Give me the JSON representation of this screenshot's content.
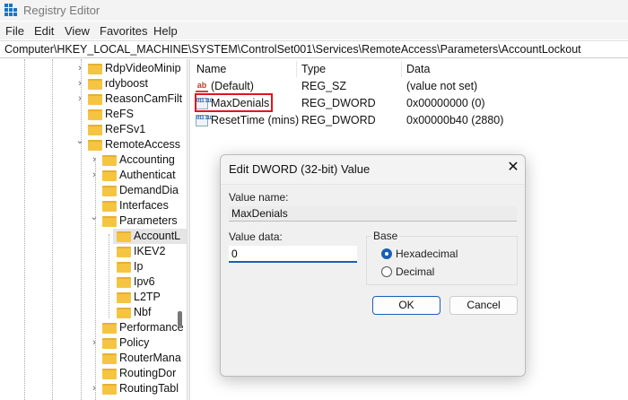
{
  "window": {
    "title": "Registry Editor"
  },
  "menu": [
    "File",
    "Edit",
    "View",
    "Favorites",
    "Help"
  ],
  "address": "Computer\\HKEY_LOCAL_MACHINE\\SYSTEM\\ControlSet001\\Services\\RemoteAccess\\Parameters\\AccountLockout",
  "tree": [
    {
      "label": "RdpVideoMinip",
      "level": 0,
      "exp": "closed"
    },
    {
      "label": "rdyboost",
      "level": 0,
      "exp": "closed"
    },
    {
      "label": "ReasonCamFilt",
      "level": 0,
      "exp": "closed"
    },
    {
      "label": "ReFS",
      "level": 0,
      "exp": "none"
    },
    {
      "label": "ReFSv1",
      "level": 0,
      "exp": "none"
    },
    {
      "label": "RemoteAccess",
      "level": 0,
      "exp": "open"
    },
    {
      "label": "Accounting",
      "level": 1,
      "exp": "closed"
    },
    {
      "label": "Authenticat",
      "level": 1,
      "exp": "closed"
    },
    {
      "label": "DemandDia",
      "level": 1,
      "exp": "none"
    },
    {
      "label": "Interfaces",
      "level": 1,
      "exp": "none"
    },
    {
      "label": "Parameters",
      "level": 1,
      "exp": "open"
    },
    {
      "label": "AccountL",
      "level": 2,
      "exp": "none",
      "selected": true
    },
    {
      "label": "IKEV2",
      "level": 2,
      "exp": "none"
    },
    {
      "label": "Ip",
      "level": 2,
      "exp": "none"
    },
    {
      "label": "Ipv6",
      "level": 2,
      "exp": "none"
    },
    {
      "label": "L2TP",
      "level": 2,
      "exp": "none"
    },
    {
      "label": "Nbf",
      "level": 2,
      "exp": "none"
    },
    {
      "label": "Performance",
      "level": 1,
      "exp": "none"
    },
    {
      "label": "Policy",
      "level": 1,
      "exp": "closed"
    },
    {
      "label": "RouterMana",
      "level": 1,
      "exp": "none"
    },
    {
      "label": "RoutingDor",
      "level": 1,
      "exp": "none"
    },
    {
      "label": "RoutingTabl",
      "level": 1,
      "exp": "closed"
    }
  ],
  "list": {
    "headers": [
      "Name",
      "Type",
      "Data"
    ],
    "rows": [
      {
        "icon": "string-value-icon",
        "name": "(Default)",
        "type": "REG_SZ",
        "data": "(value not set)"
      },
      {
        "icon": "binary-value-icon",
        "name": "MaxDenials",
        "type": "REG_DWORD",
        "data": "0x00000000 (0)"
      },
      {
        "icon": "binary-value-icon",
        "name": "ResetTime (mins)",
        "type": "REG_DWORD",
        "data": "0x00000b40 (2880)"
      }
    ]
  },
  "dialog": {
    "title": "Edit DWORD (32-bit) Value",
    "close": "✕",
    "value_name_label": "Value name:",
    "value_name": "MaxDenials",
    "value_data_label": "Value data:",
    "value_data": "0",
    "base_label": "Base",
    "hex_label": "Hexadecimal",
    "dec_label": "Decimal",
    "ok": "OK",
    "cancel": "Cancel"
  },
  "colors": {
    "highlight": "#e0141e",
    "accent": "#1a5fb4"
  }
}
